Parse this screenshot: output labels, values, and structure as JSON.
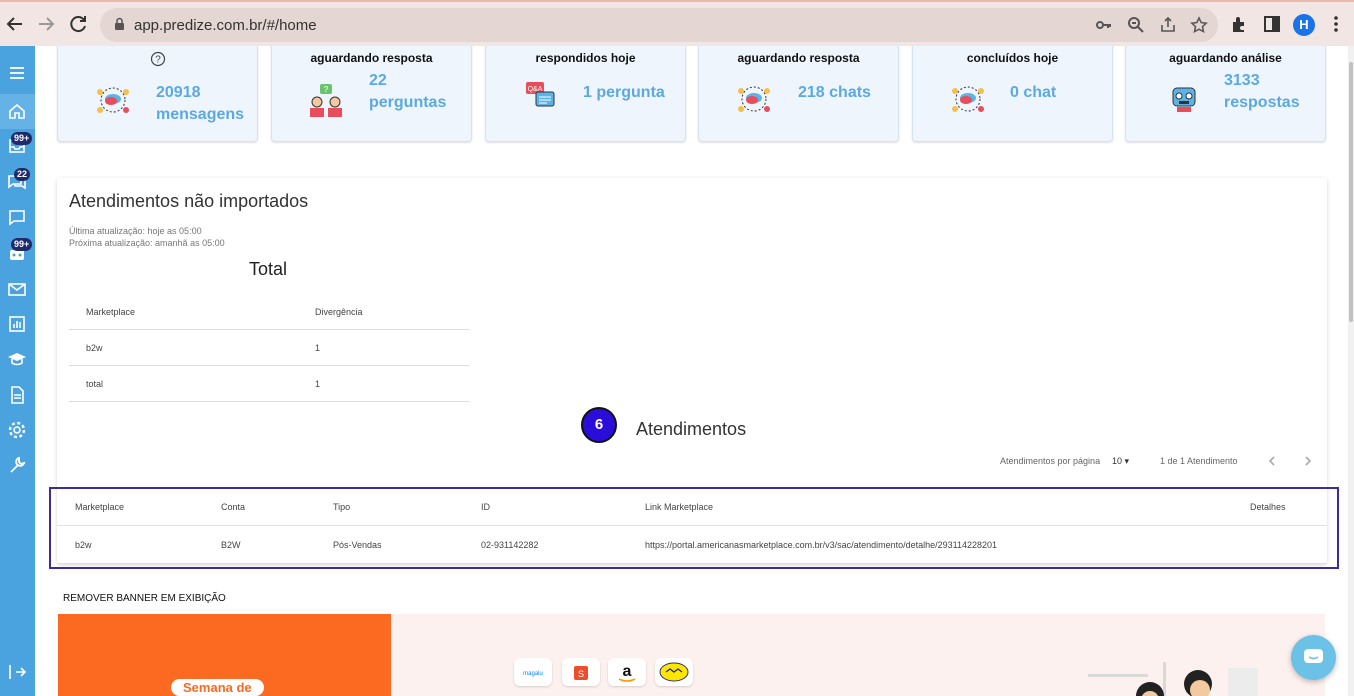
{
  "browser": {
    "url": "app.predize.com.br/#/home",
    "profile_initial": "H"
  },
  "sidebar": {
    "badges": {
      "reviews": "99+",
      "questions": "22",
      "reports": "99+"
    }
  },
  "cards": [
    {
      "title": "",
      "value": "20918 mensagens",
      "value_lines": [
        "20918",
        "mensagens"
      ],
      "help": "?"
    },
    {
      "title": "aguardando resposta",
      "value_lines": [
        "22",
        "perguntas"
      ]
    },
    {
      "title": "respondidos hoje",
      "value_lines": [
        "1 pergunta"
      ]
    },
    {
      "title": "aguardando resposta",
      "value_lines": [
        "218 chats"
      ]
    },
    {
      "title": "concluídos hoje",
      "value_lines": [
        "0 chat"
      ]
    },
    {
      "title": "aguardando análise",
      "value_lines": [
        "3133",
        "respostas"
      ]
    }
  ],
  "panel": {
    "title": "Atendimentos não importados",
    "last_update": "Última atualização: hoje as 05:00",
    "next_update": "Próxima atualização: amanhã as 05:00",
    "total_title": "Total",
    "summary_headers": [
      "Marketplace",
      "Divergência"
    ],
    "summary_rows": [
      [
        "b2w",
        "1"
      ],
      [
        "total",
        "1"
      ]
    ],
    "count": "6",
    "atendimentos_title": "Atendimentos",
    "per_page_label": "Atendimentos por página",
    "per_page_value": "10",
    "page_info": "1 de 1 Atendimento",
    "table_headers": [
      "Marketplace",
      "Conta",
      "Tipo",
      "ID",
      "Link Marketplace",
      "Detalhes"
    ],
    "table_rows": [
      [
        "b2w",
        "B2W",
        "Pós-Vendas",
        "02-931142282",
        "https://portal.americanasmarketplace.com.br/v3/sac/atendimento/detalhe/293114228201",
        ""
      ]
    ]
  },
  "banner": {
    "remove_label": "REMOVER BANNER EM EXIBIÇÃO",
    "semana_label": "Semana de"
  },
  "colors": {
    "accent": "#4aa3df",
    "value_blue": "#5ca9e2",
    "highlight": "#3d2ba1",
    "circle": "#2b0dd9",
    "banner_orange": "#fb6a20"
  }
}
